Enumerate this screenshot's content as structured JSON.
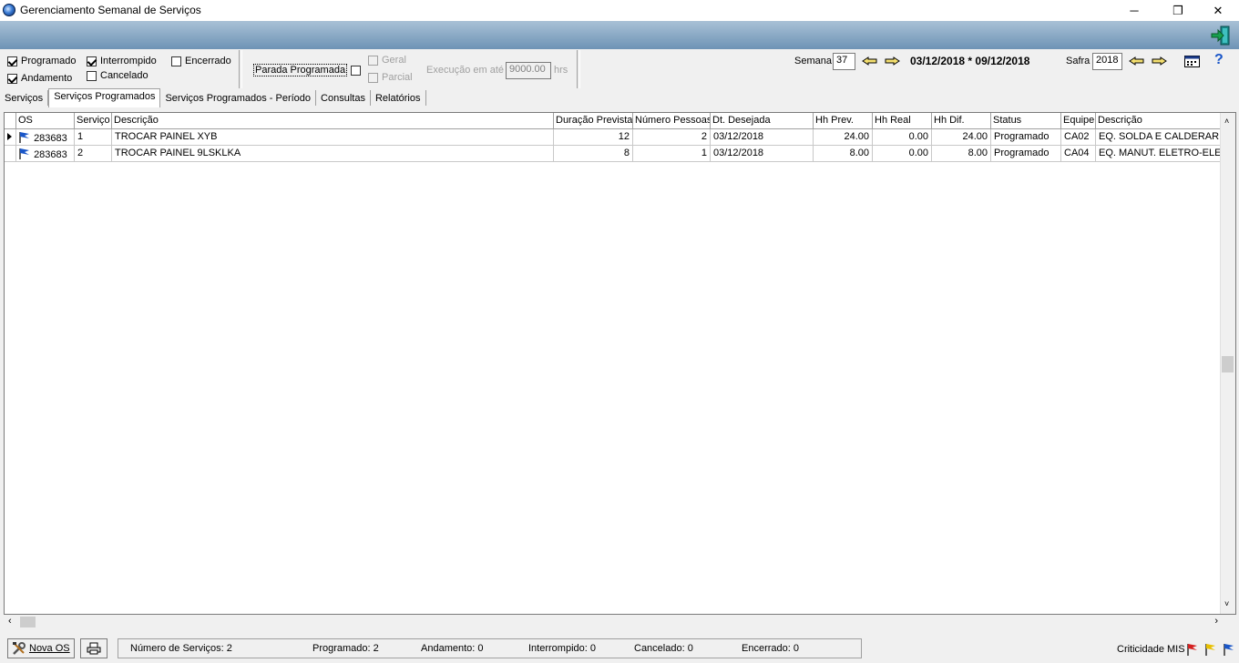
{
  "window": {
    "title": "Gerenciamento Semanal de Serviços",
    "minimize": "─",
    "restore": "❐",
    "close": "✕"
  },
  "filters": {
    "programado": "Programado",
    "andamento": "Andamento",
    "interrompido": "Interrompido",
    "cancelado": "Cancelado",
    "encerrado": "Encerrado",
    "parada_programada": "Parada Programada",
    "geral": "Geral",
    "parcial": "Parcial",
    "execucao_label": "Execução em até",
    "execucao_value": "9000.00",
    "execucao_unit": "hrs"
  },
  "week": {
    "label": "Semana",
    "value": "37",
    "range": "03/12/2018 * 09/12/2018"
  },
  "safra": {
    "label": "Safra",
    "value": "2018"
  },
  "tabs": [
    {
      "label": "Serviços"
    },
    {
      "label": "Serviços Programados"
    },
    {
      "label": "Serviços Programados - Período"
    },
    {
      "label": "Consultas"
    },
    {
      "label": "Relatórios"
    }
  ],
  "table": {
    "columns": [
      "OS",
      "Serviço",
      "Descrição",
      "Duração Prevista",
      "Número Pessoas",
      "Dt. Desejada",
      "Hh Prev.",
      "Hh Real",
      "Hh Dif.",
      "Status",
      "Equipe",
      "Descrição"
    ],
    "rows": [
      {
        "os": "283683",
        "servico": "1",
        "descricao": "TROCAR PAINEL XYB",
        "duracao": "12",
        "pessoas": "2",
        "dt": "03/12/2018",
        "hh_prev": "24.00",
        "hh_real": "0.00",
        "hh_dif": "24.00",
        "status": "Programado",
        "equipe": "CA02",
        "equipe_desc": "EQ. SOLDA E CALDERARIA"
      },
      {
        "os": "283683",
        "servico": "2",
        "descricao": "TROCAR PAINEL 9LSKLKA",
        "duracao": "8",
        "pessoas": "1",
        "dt": "03/12/2018",
        "hh_prev": "8.00",
        "hh_real": "0.00",
        "hh_dif": "8.00",
        "status": "Programado",
        "equipe": "CA04",
        "equipe_desc": "EQ. MANUT.  ELETRO-ELETR"
      }
    ]
  },
  "statusbar": {
    "nova_os": "Nova OS",
    "numero_servicos": "Número de Serviços: 2",
    "programado": "Programado: 2",
    "andamento": "Andamento: 0",
    "interrompido": "Interrompido: 0",
    "cancelado": "Cancelado: 0",
    "encerrado": "Encerrado: 0",
    "criticidade": "Criticidade MIS"
  },
  "colors": {
    "ribbon_top": "#a9c1d6",
    "ribbon_bottom": "#6d93b5",
    "flag_blue": "#1a56c8",
    "flag_red": "#d42020",
    "flag_yellow": "#e8c000"
  }
}
